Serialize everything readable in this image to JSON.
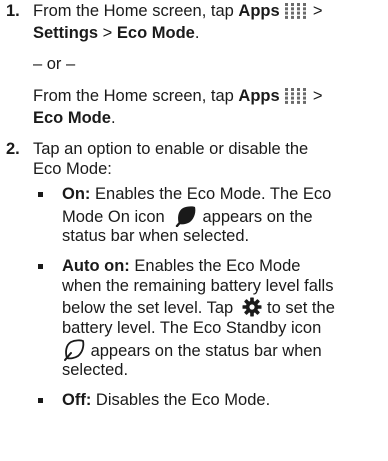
{
  "steps": [
    {
      "number": "1.",
      "lines": [
        {
          "pre": "From the Home screen, tap ",
          "bold1": "Apps",
          "post": " >"
        },
        {
          "bold1": "Settings",
          "sep": " > ",
          "bold2": "Eco Mode",
          "post": "."
        }
      ],
      "or_label": "– or –",
      "alt_lines": [
        {
          "pre": "From the Home screen, tap ",
          "bold1": "Apps",
          "post": " >"
        },
        {
          "bold1": "Eco Mode",
          "post": "."
        }
      ]
    },
    {
      "number": "2.",
      "lines": [
        {
          "text": "Tap an option to enable or disable the"
        },
        {
          "text": "Eco Mode:"
        }
      ]
    }
  ],
  "options": [
    {
      "label": "On:",
      "lines": [
        " Enables the Eco Mode. The Eco",
        {
          "pre": "Mode On icon ",
          "post": " appears on the"
        },
        "status bar when selected."
      ],
      "icon": "eco-mode-on-icon"
    },
    {
      "label": "Auto on:",
      "lines": [
        " Enables the Eco Mode",
        "when the remaining battery level falls",
        {
          "pre": "below the set level. Tap ",
          "post": " to set the"
        },
        "battery level. The Eco Standby icon",
        {
          "pre": "",
          "post": " appears on the status bar when"
        },
        "selected."
      ],
      "icons": [
        "gear-icon",
        "eco-standby-icon"
      ]
    },
    {
      "label": "Off:",
      "lines": [
        " Disables the Eco Mode."
      ]
    }
  ],
  "colors": {
    "text": "#1a1a1a",
    "apps_icon_dots": "#6b6b6b"
  }
}
